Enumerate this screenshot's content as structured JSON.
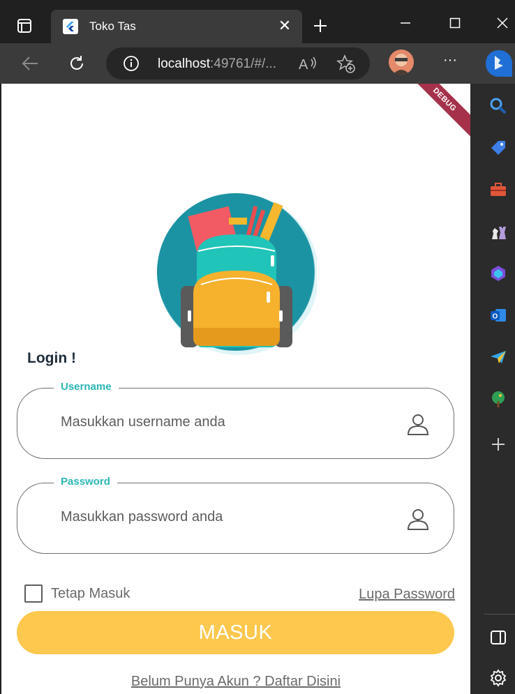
{
  "browser": {
    "tab_title": "Toko Tas",
    "url_host": "localhost",
    "url_rest": ":49761/#/...",
    "close_symbol": "✕",
    "more_symbol": "···"
  },
  "app": {
    "debug_banner": "DEBUG",
    "login_title": "Login !",
    "username": {
      "label": "Username",
      "placeholder": "Masukkan username anda",
      "value": ""
    },
    "password": {
      "label": "Password",
      "placeholder": "Masukkan password anda",
      "value": ""
    },
    "remember_label": "Tetap Masuk",
    "remember_checked": false,
    "forgot_link": "Lupa Password",
    "submit_label": "MASUK",
    "register_link": "Belum Punya Akun ? Daftar Disini"
  },
  "colors": {
    "accent_teal": "#2bb6b6",
    "button_yellow": "#fec84e",
    "debug_red": "#a5314a"
  },
  "sidebar_icons": [
    "search-icon",
    "tag-icon",
    "toolbox-icon",
    "chess-icon",
    "copilot-icon",
    "outlook-icon",
    "send-icon",
    "tree-icon",
    "add-icon",
    "split-screen-icon",
    "settings-icon"
  ]
}
